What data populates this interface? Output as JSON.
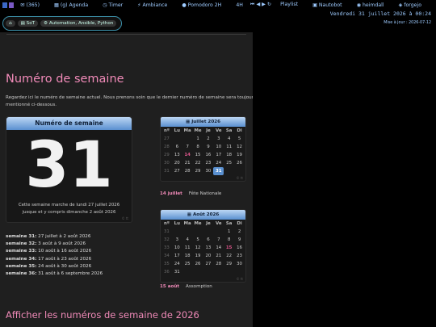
{
  "topbar": {
    "items": [
      "(365)",
      "(g) Agenda",
      "Timer",
      "Ambiance",
      "Pomodoro 2H",
      "4H",
      "Playlist",
      "Nautobot",
      "heimdall",
      "forgejo"
    ],
    "controls": "⏮ ◀ ▶ ↻"
  },
  "date": "Vendredi 31 juillet 2026 à 00:24",
  "updated": "Mise à jour : 2026-07-12",
  "pills": {
    "sot": "SoT",
    "automation": "Automation, Ansible, Python"
  },
  "page": {
    "title": "Numéro de semaine",
    "intro": "Regardez ici le numéro de semaine actuel. Nous prenons soin que le dernier numéro de semaine sera toujours mentionné ci-dessous.",
    "card": {
      "header": "Numéro de semaine",
      "number": "31",
      "line1": "Cette semaine marche de lundi 27 juillet 2026",
      "line2": "jusque et y compris dimanche 2 août 2026",
      "watermark": "© tt"
    },
    "weeks": [
      {
        "label": "semaine 31:",
        "range": "27 juillet à 2 août 2026"
      },
      {
        "label": "semaine 32:",
        "range": "3 août à 9 août 2026"
      },
      {
        "label": "semaine 33:",
        "range": "10 août à 16 août 2026"
      },
      {
        "label": "semaine 34:",
        "range": "17 août à 23 août 2026"
      },
      {
        "label": "semaine 35:",
        "range": "24 août à 30 août 2026"
      },
      {
        "label": "semaine 36:",
        "range": "31 août à 6 septembre 2026"
      }
    ],
    "calendars": [
      {
        "title": "Juillet 2026",
        "days": [
          "nº",
          "Lu",
          "Ma",
          "Me",
          "Je",
          "Ve",
          "Sa",
          "Di"
        ],
        "rows": [
          [
            "27",
            "",
            "",
            "1",
            "2",
            "3",
            "4",
            "5"
          ],
          [
            "28",
            "6",
            "7",
            "8",
            "9",
            "10",
            "11",
            "12"
          ],
          [
            "29",
            "13",
            "14",
            "15",
            "16",
            "17",
            "18",
            "19"
          ],
          [
            "30",
            "20",
            "21",
            "22",
            "23",
            "24",
            "25",
            "26"
          ],
          [
            "31",
            "27",
            "28",
            "29",
            "30",
            "31",
            "",
            ""
          ]
        ],
        "highlight": "14",
        "selected": "31",
        "watermark": "© tt",
        "holiday_date": "14 juillet",
        "holiday_name": "Fête Nationale"
      },
      {
        "title": "Août 2026",
        "days": [
          "nº",
          "Lu",
          "Ma",
          "Me",
          "Je",
          "Ve",
          "Sa",
          "Di"
        ],
        "rows": [
          [
            "31",
            "",
            "",
            "",
            "",
            "",
            "1",
            "2"
          ],
          [
            "32",
            "3",
            "4",
            "5",
            "6",
            "7",
            "8",
            "9"
          ],
          [
            "33",
            "10",
            "11",
            "12",
            "13",
            "14",
            "15",
            "16"
          ],
          [
            "34",
            "17",
            "18",
            "19",
            "20",
            "21",
            "22",
            "23"
          ],
          [
            "35",
            "24",
            "25",
            "26",
            "27",
            "28",
            "29",
            "30"
          ],
          [
            "36",
            "31",
            "",
            "",
            "",
            "",
            "",
            ""
          ]
        ],
        "highlight": "15",
        "selected": "",
        "watermark": "© tt",
        "holiday_date": "15 août",
        "holiday_name": "Assomption"
      }
    ],
    "subtitle": "Afficher les numéros de semaine de 2026"
  }
}
